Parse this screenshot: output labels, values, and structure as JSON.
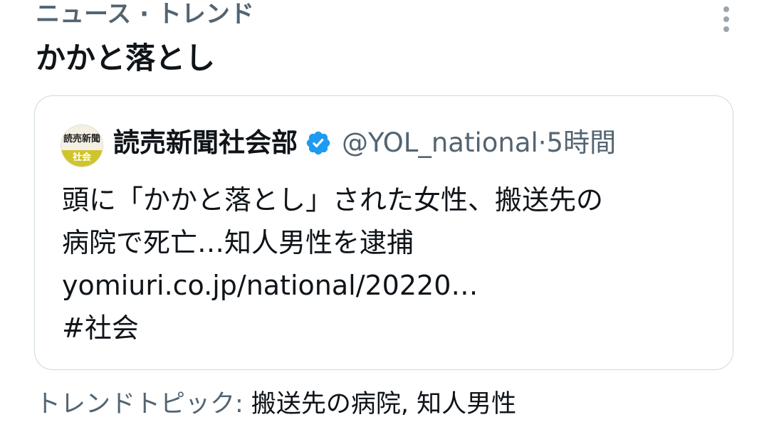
{
  "trend": {
    "category": "ニュース · トレンド",
    "title": "かかと落とし",
    "more_icon": "more-vertical-icon"
  },
  "tweet": {
    "avatar_text_top": "読売新聞",
    "avatar_text_bottom": "社会",
    "author_name": "読売新聞社会部",
    "verified_icon": "verified-badge-icon",
    "verified_color": "#1d9bf0",
    "handle": "@YOL_national",
    "separator": " · ",
    "time": "5時間",
    "text_line1": "頭に「かかと落とし」された女性、搬送先の",
    "text_line2": "病院で死亡…知人男性を逮捕",
    "link": "yomiuri.co.jp/national/20220…",
    "hashtag": "#社会"
  },
  "footer": {
    "label": "トレンドトピック: ",
    "topics": "搬送先の病院, 知人男性"
  }
}
